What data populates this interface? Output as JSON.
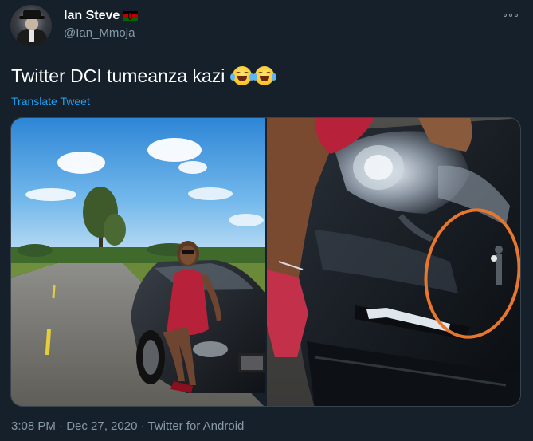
{
  "author": {
    "display_name": "Ian Steve",
    "flag_icon": "kenya-flag-icon",
    "handle": "@Ian_Mmoja"
  },
  "menu": {
    "icon": "more-options-icon"
  },
  "tweet": {
    "text": "Twitter DCI tumeanza kazi",
    "emojis": [
      "face-with-tears-of-joy",
      "face-with-tears-of-joy"
    ],
    "translate_label": "Translate Tweet"
  },
  "media": {
    "photos": [
      "photo-woman-sitting-on-car-hood",
      "photo-car-headlight-closeup-circled"
    ],
    "annotation_color": "#e8772e"
  },
  "meta": {
    "footer": "3:08 PM · Dec 27, 2020 · Twitter for Android"
  },
  "colors": {
    "background": "#15202b",
    "text": "#ffffff",
    "secondary_text": "#8899a6",
    "link": "#1da1f2"
  }
}
